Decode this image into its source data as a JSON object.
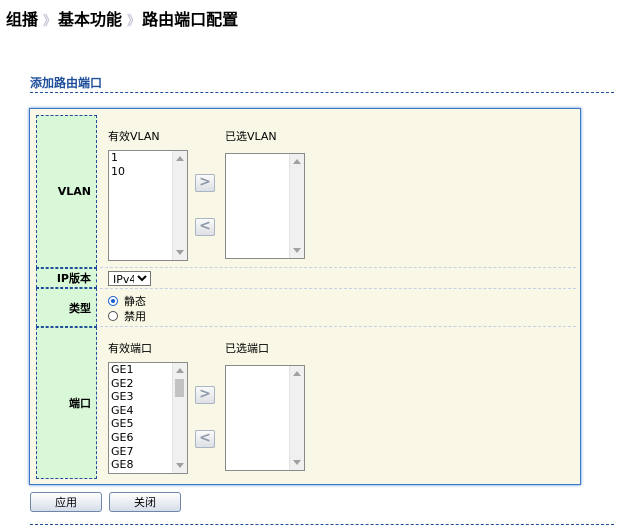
{
  "breadcrumb": {
    "level1": "组播",
    "level2": "基本功能",
    "level3": "路由端口配置",
    "separator": "》"
  },
  "section_title": "添加路由端口",
  "vlan": {
    "label": "VLAN",
    "available_caption": "有效VLAN",
    "selected_caption": "已选VLAN",
    "available": [
      "1",
      "10"
    ],
    "selected": [],
    "add_arrow": ">",
    "remove_arrow": "<"
  },
  "ip_version": {
    "label": "IP版本",
    "value": "IPv4"
  },
  "type": {
    "label": "类型",
    "options": [
      "静态",
      "禁用"
    ],
    "selected": "静态"
  },
  "port": {
    "label": "端口",
    "available_caption": "有效端口",
    "selected_caption": "已选端口",
    "available": [
      "GE1",
      "GE2",
      "GE3",
      "GE4",
      "GE5",
      "GE6",
      "GE7",
      "GE8"
    ],
    "selected": [],
    "add_arrow": ">",
    "remove_arrow": "<"
  },
  "buttons": {
    "apply": "应用",
    "close": "关闭"
  },
  "colors": {
    "accent": "#1f4f9a",
    "panel_bg": "#f9f7e6",
    "label_bg": "#d8f8d8",
    "radio_checked": "#1a5fd0"
  }
}
